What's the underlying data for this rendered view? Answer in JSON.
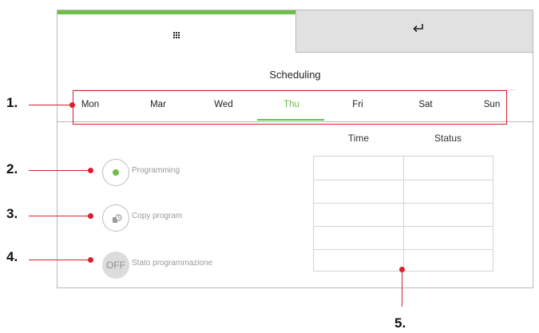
{
  "header": {
    "active_tab_icon": "grid-icon",
    "back_tab_icon": "return-arrow-icon",
    "active_accent": "#6cbf4b"
  },
  "title": "Scheduling",
  "days": [
    "Mon",
    "Mar",
    "Wed",
    "Thu",
    "Fri",
    "Sat",
    "Sun"
  ],
  "selected_day": "Thu",
  "table": {
    "columns": [
      "Time",
      "Status"
    ],
    "row_count": 5
  },
  "buttons": {
    "programming": "Programming",
    "copy_program": "Copy program",
    "toggle_value": "OFF",
    "toggle_label": "Stato programmazione"
  },
  "callouts": [
    "1.",
    "2.",
    "3.",
    "4.",
    "5."
  ],
  "annotation_color": "#d6202a"
}
